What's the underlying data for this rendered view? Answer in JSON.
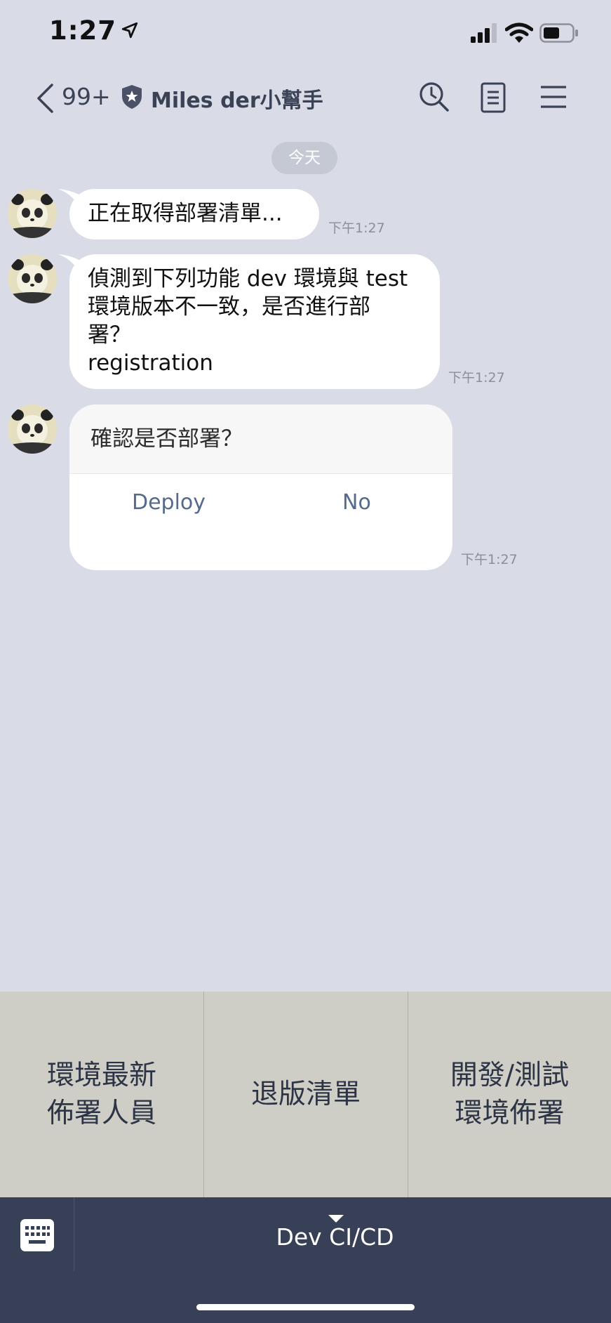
{
  "status": {
    "time": "1:27"
  },
  "header": {
    "back_count": "99+",
    "title": "Miles der小幫手"
  },
  "date_separator": "今天",
  "messages": [
    {
      "text": "正在取得部署清單...",
      "time": "下午1:27"
    },
    {
      "lines": [
        "偵測到下列功能 dev 環境與 test",
        "環境版本不一致，是否進行部",
        "署？",
        "registration"
      ],
      "time": "下午1:27"
    }
  ],
  "confirm": {
    "title": "確認是否部署？",
    "deploy_label": "Deploy",
    "no_label": "No",
    "time": "下午1:27"
  },
  "rich_menu": {
    "items": [
      {
        "line1": "環境最新",
        "line2": "佈署人員"
      },
      {
        "line1": "退版清單"
      },
      {
        "line1": "開發/測試",
        "line2": "環境佈署"
      }
    ]
  },
  "bottom_bar": {
    "label": "Dev CI/CD"
  },
  "icons": {
    "location": "location-arrow-icon",
    "signal": "signal-icon",
    "wifi": "wifi-icon",
    "battery": "battery-icon",
    "back": "chevron-left-icon",
    "badge": "shield-star-icon",
    "search": "search-icon",
    "notes": "notes-icon",
    "menu": "hamburger-menu-icon",
    "keyboard": "keyboard-icon",
    "toggle": "caret-down-icon"
  }
}
